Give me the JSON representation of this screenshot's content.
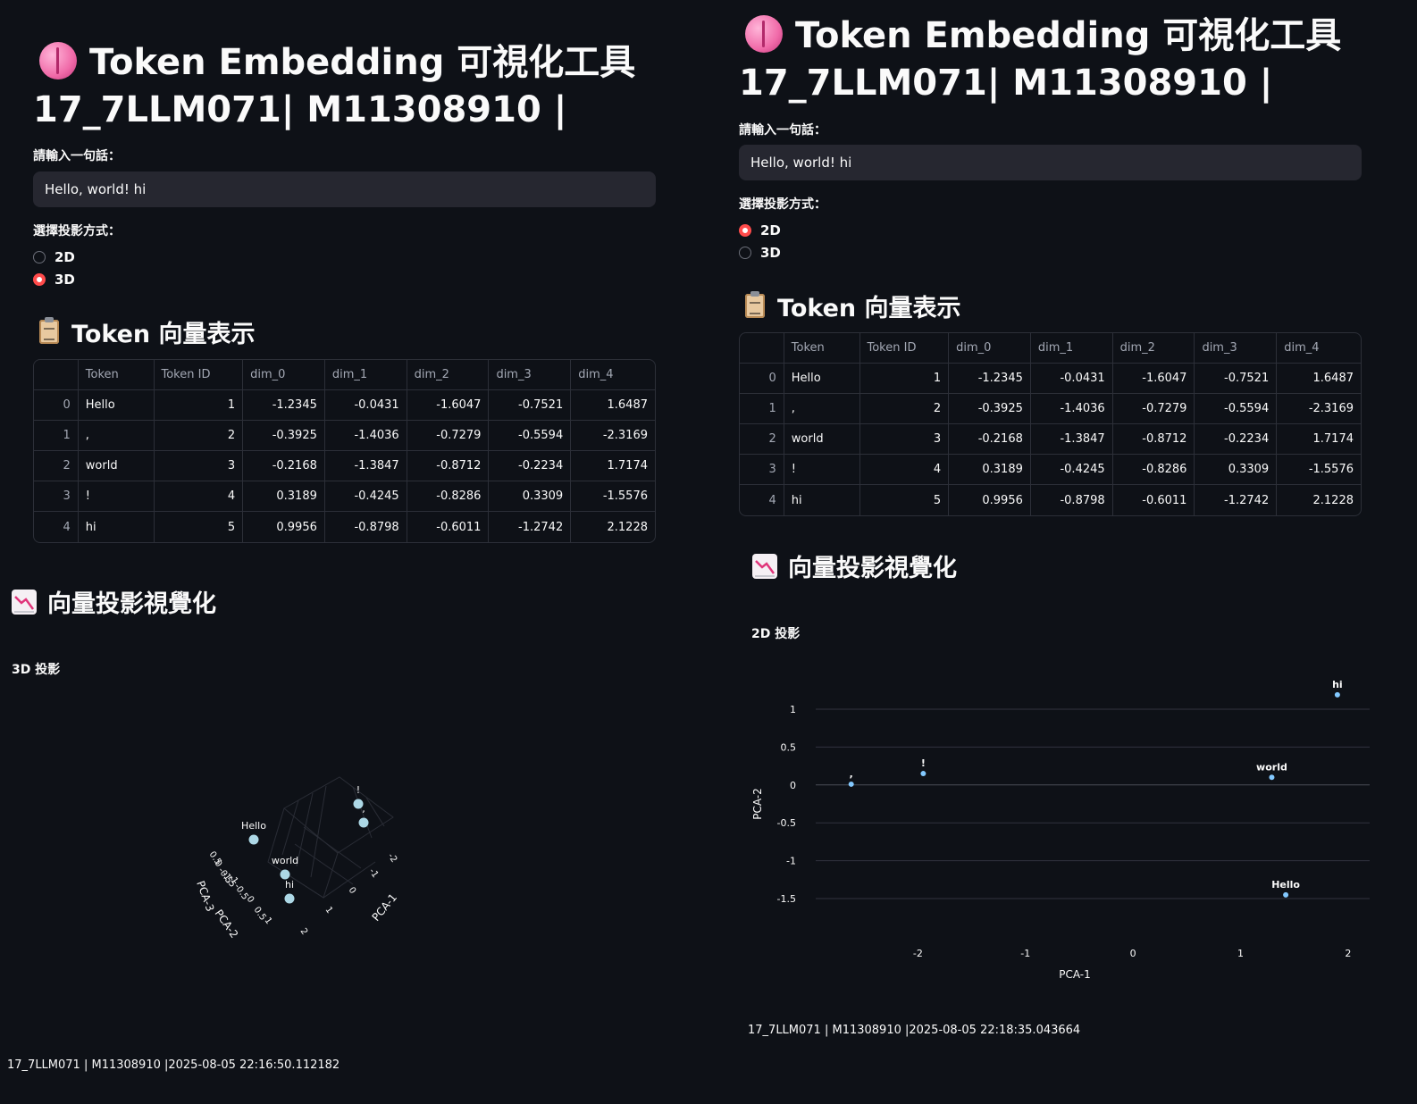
{
  "left": {
    "title_line1": "Token Embedding 可視化工具",
    "title_line2": "17_7LLM071| M11308910 |",
    "input_label": "請輸入一句話：",
    "input_value": "Hello, world! hi",
    "radio_label": "選擇投影方式：",
    "radio_options": [
      "2D",
      "3D"
    ],
    "radio_selected": "3D",
    "table_heading": "Token 向量表示",
    "viz_heading": "向量投影視覺化",
    "chart_subtitle": "3D 投影",
    "footer": "17_7LLM071 | M11308910 |2025-08-05 22:16:50.112182"
  },
  "right": {
    "title_line1": "Token Embedding 可視化工具",
    "title_line2": "17_7LLM071| M11308910 |",
    "input_label": "請輸入一句話：",
    "input_value": "Hello, world! hi",
    "radio_label": "選擇投影方式：",
    "radio_options": [
      "2D",
      "3D"
    ],
    "radio_selected": "2D",
    "table_heading": "Token 向量表示",
    "viz_heading": "向量投影視覺化",
    "chart_subtitle": "2D 投影",
    "footer": "17_7LLM071 | M11308910 |2025-08-05 22:18:35.043664"
  },
  "table": {
    "columns": [
      "",
      "Token",
      "Token ID",
      "dim_0",
      "dim_1",
      "dim_2",
      "dim_3",
      "dim_4"
    ],
    "rows": [
      [
        "0",
        "Hello",
        "1",
        "-1.2345",
        "-0.0431",
        "-1.6047",
        "-0.7521",
        "1.6487"
      ],
      [
        "1",
        ",",
        "2",
        "-0.3925",
        "-1.4036",
        "-0.7279",
        "-0.5594",
        "-2.3169"
      ],
      [
        "2",
        "world",
        "3",
        "-0.2168",
        "-1.3847",
        "-0.8712",
        "-0.2234",
        "1.7174"
      ],
      [
        "3",
        "!",
        "4",
        "0.3189",
        "-0.4245",
        "-0.8286",
        "0.3309",
        "-1.5576"
      ],
      [
        "4",
        "hi",
        "5",
        "0.9956",
        "-0.8798",
        "-0.6011",
        "-1.2742",
        "2.1228"
      ]
    ]
  },
  "icons": {
    "title": "brain-icon",
    "table_heading": "clipboard-icon",
    "viz_heading": "chart-decreasing-icon"
  },
  "colors": {
    "background": "#0e1117",
    "accent": "#ff4b4b",
    "marker_2d": "#83c9ff",
    "marker_3d": "#add8e6"
  },
  "chart_data": [
    {
      "type": "scatter",
      "dimensions": 3,
      "title": "3D 投影",
      "axis_labels": [
        "PCA-1",
        "PCA-2",
        "PCA-3"
      ],
      "x_ticks": [
        "-2",
        "-1",
        "0",
        "1",
        "2"
      ],
      "y_ticks": [
        "-1.5",
        "-1",
        "-0.5",
        "0",
        "0.5",
        "1"
      ],
      "z_ticks": [
        "-0.5",
        "0",
        "0.5"
      ],
      "points": [
        {
          "label": "Hello"
        },
        {
          "label": ","
        },
        {
          "label": "world"
        },
        {
          "label": "!"
        },
        {
          "label": "hi"
        }
      ]
    },
    {
      "type": "scatter",
      "title": "2D 投影",
      "xlabel": "PCA-1",
      "ylabel": "PCA-2",
      "x_ticks": [
        -2,
        -1,
        0,
        1,
        2
      ],
      "y_ticks": [
        1,
        0.5,
        0,
        -0.5,
        -1,
        -1.5
      ],
      "xlim": [
        -2.95,
        2.2
      ],
      "ylim": [
        -1.9,
        1.4
      ],
      "grid": true,
      "points": [
        {
          "label": "Hello",
          "x": 1.42,
          "y": -1.45
        },
        {
          "label": ",",
          "x": -2.62,
          "y": 0.01
        },
        {
          "label": "world",
          "x": 1.29,
          "y": 0.1
        },
        {
          "label": "!",
          "x": -1.95,
          "y": 0.15
        },
        {
          "label": "hi",
          "x": 1.9,
          "y": 1.19
        }
      ]
    }
  ]
}
